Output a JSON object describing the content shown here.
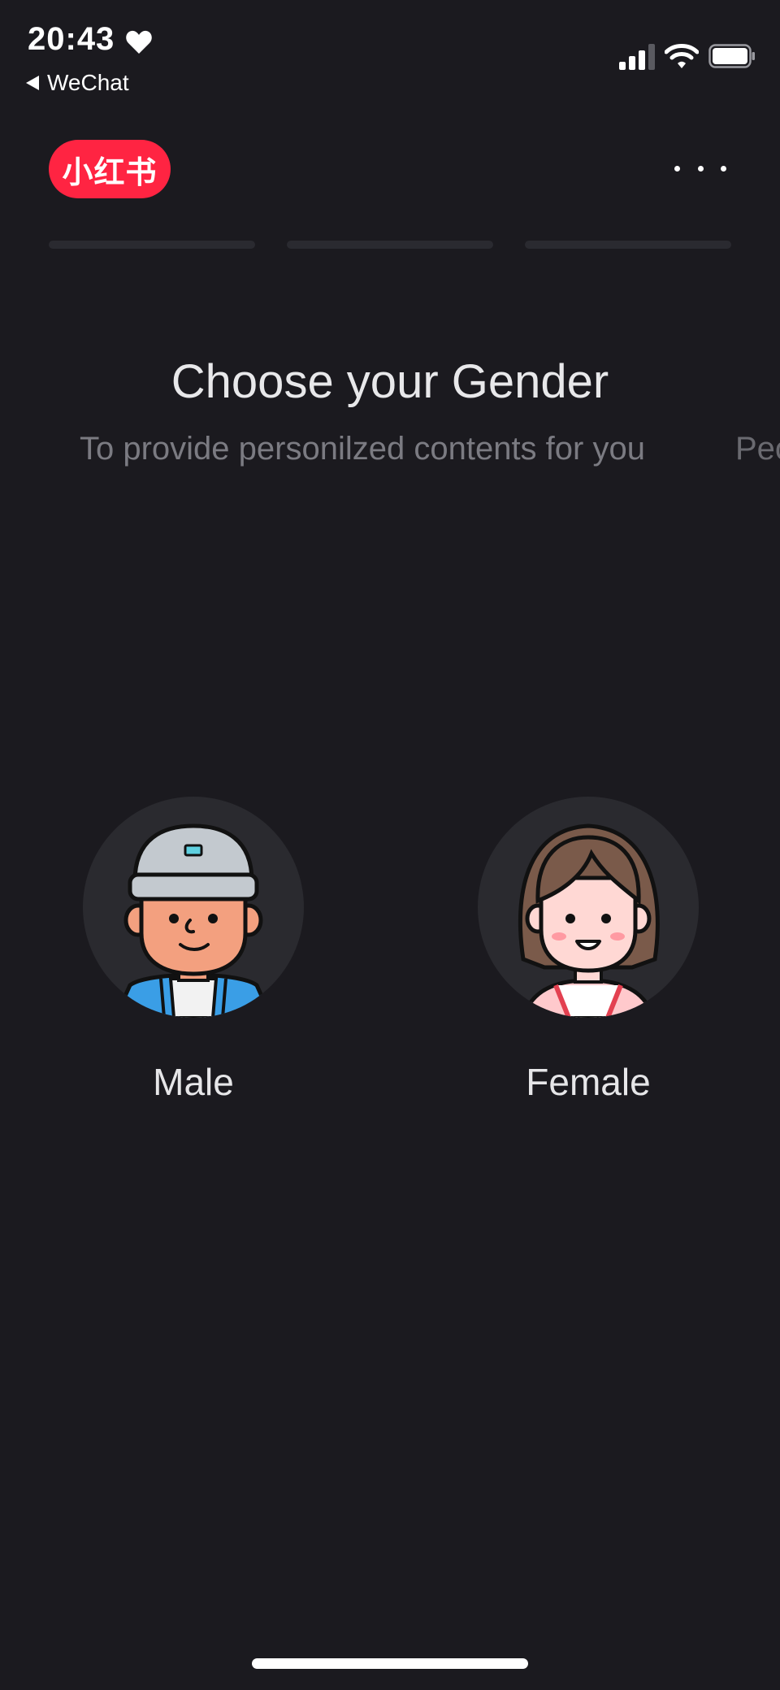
{
  "status_bar": {
    "time": "20:43",
    "back_label": "WeChat",
    "icons": [
      "heart-icon",
      "signal-icon",
      "wifi-icon",
      "battery-icon"
    ]
  },
  "header": {
    "logo_text": "小红书",
    "logo_color": "#ff2442",
    "more_icon": "more-dots-icon"
  },
  "onboarding": {
    "steps_total": 3,
    "title": "Choose your Gender",
    "subtitle": "To provide personilzed contents for you",
    "next_subtitle_fragment": "Peo"
  },
  "options": [
    {
      "label": "Male",
      "avatar": "male-avatar-icon"
    },
    {
      "label": "Female",
      "avatar": "female-avatar-icon"
    }
  ],
  "colors": {
    "background": "#1b1a1f",
    "avatar_background": "#2a2a2f",
    "subtitle": "#7b7b82"
  }
}
